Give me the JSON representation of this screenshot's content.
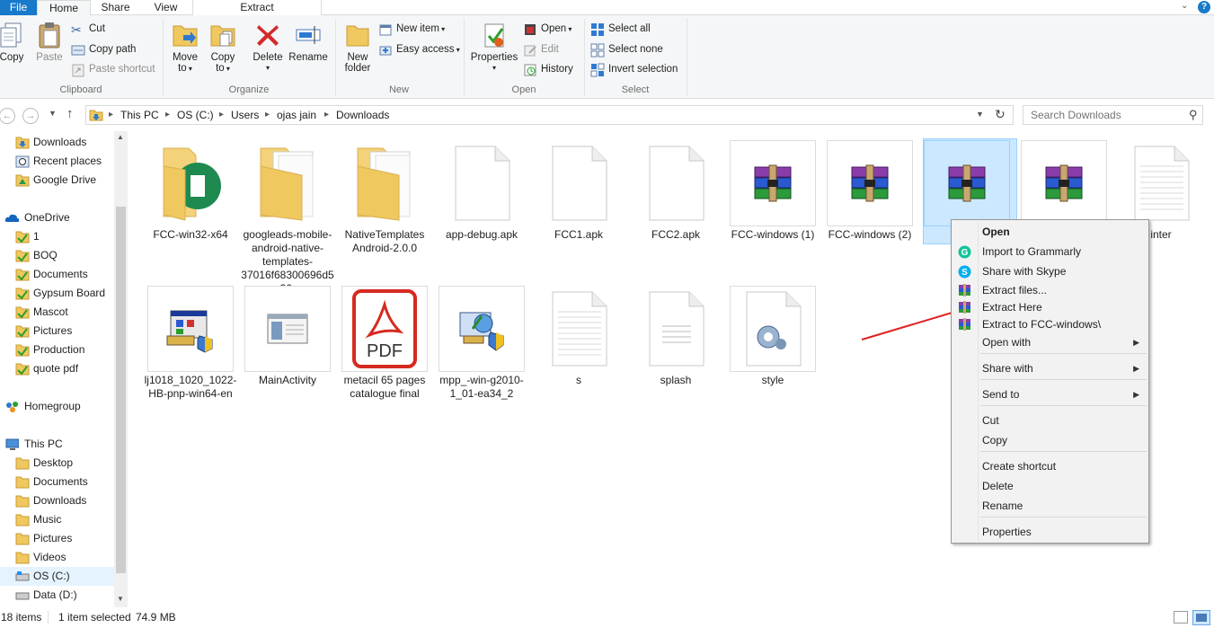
{
  "tabs": {
    "file": "File",
    "home": "Home",
    "share": "Share",
    "view": "View",
    "extract": "Extract"
  },
  "ribbon": {
    "clipboard": {
      "copy": "Copy",
      "paste": "Paste",
      "cut": "Cut",
      "copy_path": "Copy path",
      "paste_shortcut": "Paste shortcut",
      "label": "Clipboard"
    },
    "organize": {
      "move_to_1": "Move",
      "move_to_2": "to",
      "copy_to_1": "Copy",
      "copy_to_2": "to",
      "delete": "Delete",
      "rename": "Rename",
      "label": "Organize"
    },
    "new": {
      "new_folder_1": "New",
      "new_folder_2": "folder",
      "new_item": "New item",
      "easy_access": "Easy access",
      "label": "New"
    },
    "open": {
      "properties": "Properties",
      "open": "Open",
      "edit": "Edit",
      "history": "History",
      "label": "Open"
    },
    "select": {
      "select_all": "Select all",
      "select_none": "Select none",
      "invert": "Invert selection",
      "label": "Select"
    }
  },
  "address": {
    "crumbs": [
      "This PC",
      "OS (C:)",
      "Users",
      "ojas jain",
      "Downloads"
    ],
    "search_placeholder": "Search Downloads"
  },
  "nav": {
    "quick": [
      "Downloads",
      "Recent places",
      "Google Drive"
    ],
    "onedrive": "OneDrive",
    "onedrive_items": [
      "1",
      "BOQ",
      "Documents",
      "Gypsum Board",
      "Mascot",
      "Pictures",
      "Production",
      "quote pdf"
    ],
    "homegroup": "Homegroup",
    "thispc": "This PC",
    "thispc_items": [
      "Desktop",
      "Documents",
      "Downloads",
      "Music",
      "Pictures",
      "Videos",
      "OS (C:)",
      "Data (D:)"
    ]
  },
  "files": [
    {
      "name": "FCC-win32-x64",
      "type": "folder-green"
    },
    {
      "name": "googleads-mobile-android-native-templates-37016f68300696d5a30...",
      "type": "folder"
    },
    {
      "name": "NativeTemplates Android-2.0.0",
      "type": "folder"
    },
    {
      "name": "app-debug.apk",
      "type": "blank"
    },
    {
      "name": "FCC1.apk",
      "type": "blank"
    },
    {
      "name": "FCC2.apk",
      "type": "blank"
    },
    {
      "name": "FCC-windows (1)",
      "type": "rar"
    },
    {
      "name": "FCC-windows (2)",
      "type": "rar"
    },
    {
      "name": "FCC",
      "type": "rar"
    },
    {
      "name": "",
      "type": "rar"
    },
    {
      "name": "inter",
      "type": "text"
    },
    {
      "name": "lj1018_1020_1022-HB-pnp-win64-en",
      "type": "installer"
    },
    {
      "name": "MainActivity",
      "type": "window"
    },
    {
      "name": "metacil 65 pages catalogue final",
      "type": "pdf"
    },
    {
      "name": "mpp_-win-g2010-1_01-ea34_2",
      "type": "setup"
    },
    {
      "name": "s",
      "type": "text"
    },
    {
      "name": "splash",
      "type": "doc"
    },
    {
      "name": "style",
      "type": "config"
    }
  ],
  "pdf_label": "PDF",
  "context_menu": [
    {
      "label": "Open",
      "bold": true,
      "icon": ""
    },
    {
      "label": "Import to Grammarly",
      "icon": "grammarly-icon"
    },
    {
      "label": "Share with Skype",
      "icon": "skype-icon"
    },
    {
      "label": "Extract files...",
      "icon": "winrar-icon"
    },
    {
      "label": "Extract Here",
      "icon": "winrar-icon"
    },
    {
      "label": "Extract to FCC-windows\\",
      "icon": "winrar-icon"
    },
    {
      "label": "Open with",
      "submenu": true
    },
    {
      "label": "Share with",
      "submenu": true
    },
    {
      "label": "Send to",
      "submenu": true
    },
    {
      "label": "Cut"
    },
    {
      "label": "Copy"
    },
    {
      "label": "Create shortcut"
    },
    {
      "label": "Delete"
    },
    {
      "label": "Rename"
    },
    {
      "label": "Properties"
    }
  ],
  "status": {
    "count": "18 items",
    "selected": "1 item selected",
    "size": "74.9 MB"
  },
  "colors": {
    "accent": "#1979ca",
    "selection": "#cce8ff",
    "annotation_arrow": "#e02020"
  }
}
